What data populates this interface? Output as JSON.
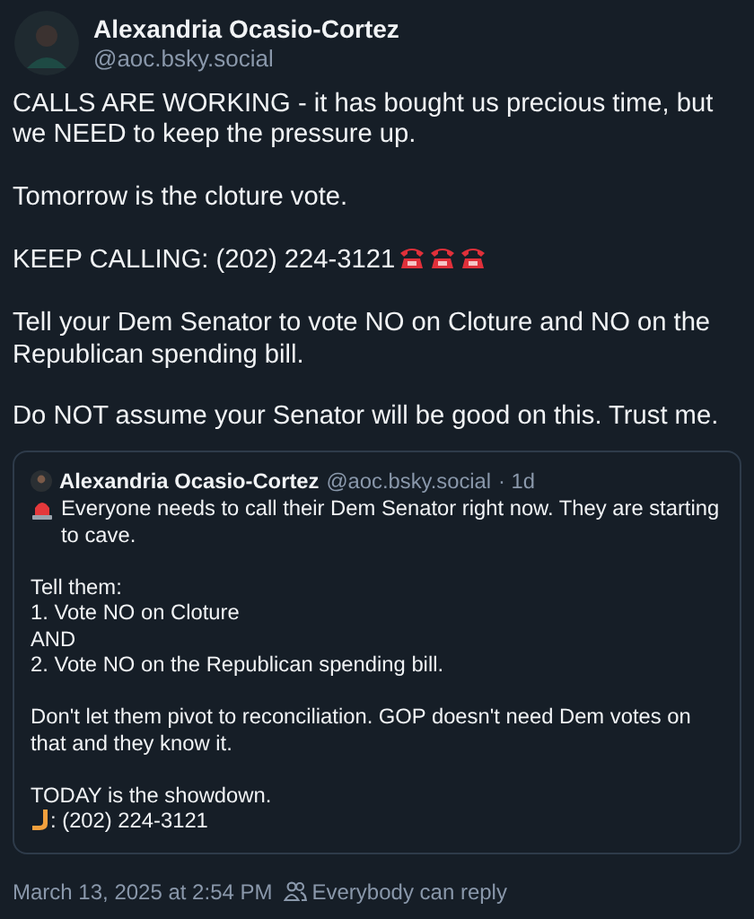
{
  "post": {
    "author": "Alexandria Ocasio-Cortez",
    "handle": "@aoc.bsky.social",
    "paragraphs": [
      {
        "kind": "text",
        "lines": [
          "CALLS ARE WORKING - it has bought us precious time, but we NEED to keep the pressure up."
        ]
      },
      {
        "kind": "text",
        "lines": [
          "Tomorrow is the cloture vote."
        ]
      },
      {
        "kind": "phones",
        "lines": [
          "KEEP CALLING: (202) 224-3121"
        ]
      },
      {
        "kind": "text",
        "lines": [
          "Tell your Dem Senator to vote NO on Cloture and NO on the Republican spending bill."
        ]
      },
      {
        "kind": "text",
        "lines": [
          "Do NOT assume your Senator will be good on this. Trust me."
        ]
      }
    ]
  },
  "quote": {
    "author": "Alexandria Ocasio-Cortez",
    "handle": "@aoc.bsky.social",
    "time": "· 1d",
    "paragraphs": [
      {
        "kind": "alert",
        "lines": [
          "Everyone needs to call their Dem Senator right now. They are starting to cave."
        ]
      },
      {
        "kind": "text",
        "lines": [
          "Tell them:",
          "1. Vote NO on Cloture",
          "AND",
          "2. Vote NO on the Republican spending bill."
        ]
      },
      {
        "kind": "text",
        "lines": [
          "Don't let them pivot to reconciliation. GOP doesn't need Dem votes on that and they know it."
        ]
      },
      {
        "kind": "call",
        "lines": [
          "TODAY is the showdown.",
          ": (202) 224-3121"
        ]
      }
    ]
  },
  "footer": {
    "date": "March 13, 2025 at 2:54 PM",
    "reply_setting": "Everybody can reply"
  }
}
